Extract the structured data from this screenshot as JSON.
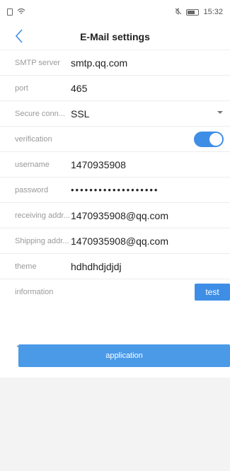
{
  "status_bar": {
    "time": "15:32"
  },
  "nav": {
    "title": "E-Mail settings",
    "back_icon": "chevron-left-icon"
  },
  "fields": [
    {
      "key": "smtp",
      "label": "SMTP server",
      "value": "smtp.qq.com"
    },
    {
      "key": "port",
      "label": "port",
      "value": "465"
    },
    {
      "key": "secure",
      "label": "Secure conn...",
      "value": "SSL"
    },
    {
      "key": "verification",
      "label": "verification",
      "value": true
    },
    {
      "key": "username",
      "label": "username",
      "value": "1470935908"
    },
    {
      "key": "password",
      "label": "password",
      "value": "•••••••••••••••••••"
    },
    {
      "key": "receiving",
      "label": "receiving addr...",
      "value": "1470935908@qq.com"
    },
    {
      "key": "shipping",
      "label": "Shipping addr...",
      "value": "1470935908@qq.com"
    },
    {
      "key": "theme",
      "label": "theme",
      "value": "hdhdhdjdjdj"
    },
    {
      "key": "information",
      "label": "information",
      "value": ""
    }
  ],
  "buttons": {
    "test": "test",
    "apply": "application"
  },
  "colors": {
    "accent": "#3f8ee6",
    "apply_button": "#4a9ae8"
  }
}
